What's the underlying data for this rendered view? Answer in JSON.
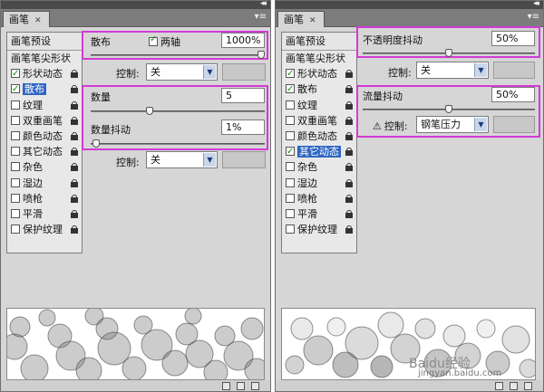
{
  "panel_left": {
    "tab_title": "画笔",
    "sidebar": {
      "presets_label": "画笔预设",
      "tip_shape_label": "画笔笔尖形状",
      "items": [
        {
          "label": "形状动态",
          "checked": true
        },
        {
          "label": "散布",
          "checked": true,
          "selected": true
        },
        {
          "label": "纹理",
          "checked": false
        },
        {
          "label": "双重画笔",
          "checked": false
        },
        {
          "label": "颜色动态",
          "checked": false
        },
        {
          "label": "其它动态",
          "checked": false
        },
        {
          "label": "杂色",
          "checked": false
        },
        {
          "label": "湿边",
          "checked": false
        },
        {
          "label": "喷枪",
          "checked": false
        },
        {
          "label": "平滑",
          "checked": false
        },
        {
          "label": "保护纹理",
          "checked": false
        }
      ]
    },
    "scatter": {
      "label": "散布",
      "both_axes_label": "两轴",
      "both_axes_checked": true,
      "value": "1000%",
      "slider_fraction": 1.0
    },
    "control1": {
      "label": "控制:",
      "value": "关"
    },
    "count": {
      "label": "数量",
      "value": "5",
      "slider_fraction": 0.33
    },
    "count_jitter": {
      "label": "数量抖动",
      "value": "1%",
      "slider_fraction": 0.01
    },
    "control2": {
      "label": "控制:",
      "value": "关"
    }
  },
  "panel_right": {
    "tab_title": "画笔",
    "sidebar": {
      "presets_label": "画笔预设",
      "tip_shape_label": "画笔笔尖形状",
      "items": [
        {
          "label": "形状动态",
          "checked": true
        },
        {
          "label": "散布",
          "checked": true
        },
        {
          "label": "纹理",
          "checked": false
        },
        {
          "label": "双重画笔",
          "checked": false
        },
        {
          "label": "颜色动态",
          "checked": false
        },
        {
          "label": "其它动态",
          "checked": true,
          "selected": true
        },
        {
          "label": "杂色",
          "checked": false
        },
        {
          "label": "湿边",
          "checked": false
        },
        {
          "label": "喷枪",
          "checked": false
        },
        {
          "label": "平滑",
          "checked": false
        },
        {
          "label": "保护纹理",
          "checked": false
        }
      ]
    },
    "opacity_jitter": {
      "label": "不透明度抖动",
      "value": "50%",
      "slider_fraction": 0.5
    },
    "control1": {
      "label": "控制:",
      "value": "关"
    },
    "flow_jitter": {
      "label": "流量抖动",
      "value": "50%",
      "slider_fraction": 0.5
    },
    "control2": {
      "label": "控制:",
      "value": "钢笔压力"
    }
  },
  "watermark": {
    "brand": "Baidu经验",
    "url": "jingyan.baidu.com"
  },
  "colors": {
    "highlight_box": "#d23ad6",
    "selected_item": "#2f66c4",
    "panel_bg": "#d6d6d6"
  }
}
